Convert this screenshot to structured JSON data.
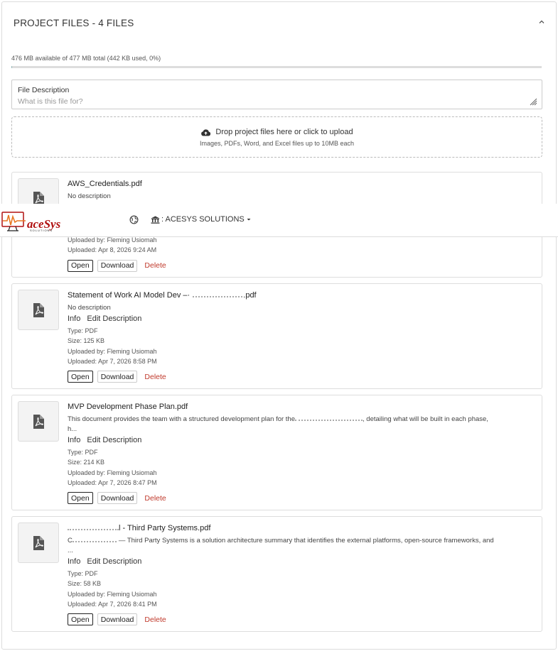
{
  "panel": {
    "title": "PROJECT FILES - 4 FILES",
    "storage_text": "476 MB available of 477 MB total (442 KB used, 0%)",
    "storage_used_fraction": 0.0009
  },
  "description_field": {
    "label": "File Description",
    "placeholder": "What is this file for?"
  },
  "dropzone": {
    "main": "Drop project files here or click to upload",
    "sub": "Images, PDFs, Word, and Excel files up to 10MB each"
  },
  "labels": {
    "info": "Info",
    "edit_description": "Edit Description",
    "open": "Open",
    "download": "Download",
    "delete": "Delete"
  },
  "files": [
    {
      "name": "AWS_Credentials.pdf",
      "description": "No description",
      "uploaded_by": "Uploaded by: Fleming Usiomah",
      "uploaded": "Uploaded: Apr 8, 2026 9:24 AM"
    },
    {
      "name": "Statement of Work AI Model Dev –·",
      "name_suffix": ".pdf",
      "description": "No description",
      "type": "Type: PDF",
      "size": "Size: 125 KB",
      "uploaded_by": "Uploaded by: Fleming Usiomah",
      "uploaded": "Uploaded: Apr 7, 2026 8:58 PM"
    },
    {
      "name": "MVP Development Phase Plan.pdf",
      "description_start": "This document provides the team with a structured development plan for the",
      "description_end": ", detailing what will be built in each phase,",
      "description_more": "h...",
      "type": "Type: PDF",
      "size": "Size: 214 KB",
      "uploaded_by": "Uploaded by: Fleming Usiomah",
      "uploaded": "Uploaded: Apr 7, 2026 8:47 PM"
    },
    {
      "name_end": "l - Third Party Systems.pdf",
      "description_start": "C",
      "description_end": "— Third Party Systems is a solution architecture summary that identifies the external platforms, open-source frameworks, and",
      "description_more": "...",
      "type": "Type: PDF",
      "size": "Size: 58 KB",
      "uploaded_by": "Uploaded by: Fleming Usiomah",
      "uploaded": "Uploaded: Apr 7, 2026 8:41 PM"
    }
  ],
  "overlay": {
    "logo_text": "aceSys",
    "logo_sub": "SOLUTIONS",
    "org_label": ": ACESYS SOLUTIONS"
  },
  "colors": {
    "delete": "#c0392b",
    "logo": "#b01010",
    "logo_accent": "#e87722"
  }
}
